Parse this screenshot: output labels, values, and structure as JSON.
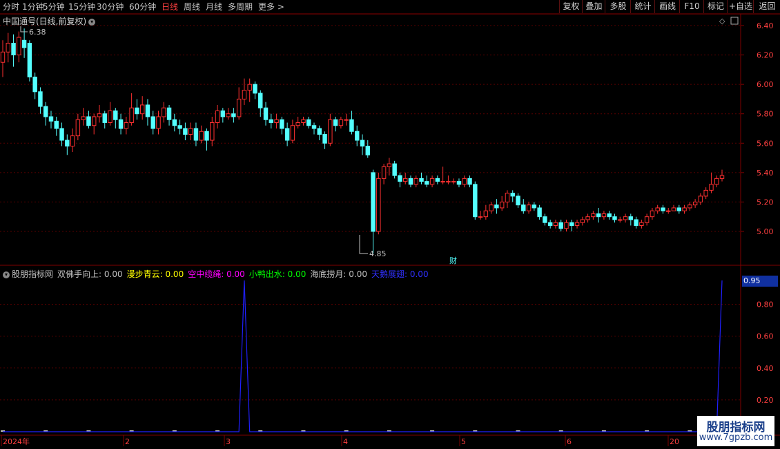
{
  "toolbar": {
    "period_tabs": [
      "分时",
      "1分钟",
      "5分钟",
      "15分钟",
      "30分钟",
      "60分钟",
      "日线",
      "周线",
      "月线",
      "多周期",
      "更多 >"
    ],
    "active_tab": "日线",
    "right_buttons": [
      "复权",
      "叠加",
      "多股",
      "统计",
      "画线",
      "F10",
      "标记",
      "+自选",
      "返回"
    ]
  },
  "main_chart": {
    "title": "中国通号(日线,前复权)",
    "high_label": "6.38",
    "low_label": "4.85",
    "finance_marker": "财",
    "y_ticks": [
      "6.40",
      "6.20",
      "6.00",
      "5.80",
      "5.60",
      "5.40",
      "5.20",
      "5.00"
    ],
    "up_color": "#ff3030",
    "down_color": "#54ffff"
  },
  "indicator": {
    "title": "股朋指标网",
    "items": [
      {
        "name": "双佛手向上",
        "value": "0.00",
        "color": "#c0c0c0"
      },
      {
        "name": "漫步青云",
        "value": "0.00",
        "color": "#ffff00"
      },
      {
        "name": "空中缆绳",
        "value": "0.00",
        "color": "#ff00ff"
      },
      {
        "name": "小鸭出水",
        "value": "0.00",
        "color": "#00ff00"
      },
      {
        "name": "海底捞月",
        "value": "0.00",
        "color": "#c0c0c0"
      },
      {
        "name": "天鹅展翅",
        "value": "0.00",
        "color": "#3030ff"
      }
    ],
    "current_value": "0.95",
    "y_ticks": [
      "0.80",
      "0.60",
      "0.40",
      "0.20"
    ]
  },
  "x_axis": {
    "labels": [
      "2024年",
      "2",
      "3",
      "4",
      "5",
      "6",
      "20"
    ]
  },
  "watermark": {
    "line1": "股朋指标网",
    "line2": "www.7gpzb.com"
  },
  "chart_data": {
    "type": "candlestick",
    "title": "中国通号(日线,前复权)",
    "ylim": [
      4.8,
      6.45
    ],
    "candles": [
      [
        6.15,
        6.22,
        6.3,
        6.05
      ],
      [
        6.22,
        6.28,
        6.35,
        6.15
      ],
      [
        6.28,
        6.2,
        6.34,
        6.12
      ],
      [
        6.2,
        6.32,
        6.36,
        6.15
      ],
      [
        6.3,
        6.25,
        6.38,
        6.18
      ],
      [
        6.28,
        6.05,
        6.3,
        6.02
      ],
      [
        6.05,
        5.95,
        6.08,
        5.9
      ],
      [
        5.95,
        5.85,
        5.98,
        5.8
      ],
      [
        5.85,
        5.78,
        5.88,
        5.72
      ],
      [
        5.78,
        5.75,
        5.82,
        5.7
      ],
      [
        5.75,
        5.7,
        5.78,
        5.65
      ],
      [
        5.7,
        5.62,
        5.74,
        5.58
      ],
      [
        5.62,
        5.58,
        5.66,
        5.52
      ],
      [
        5.58,
        5.65,
        5.7,
        5.54
      ],
      [
        5.65,
        5.76,
        5.8,
        5.62
      ],
      [
        5.76,
        5.78,
        5.84,
        5.72
      ],
      [
        5.78,
        5.72,
        5.82,
        5.7
      ],
      [
        5.72,
        5.78,
        5.8,
        5.66
      ],
      [
        5.78,
        5.8,
        5.86,
        5.74
      ],
      [
        5.8,
        5.74,
        5.82,
        5.7
      ],
      [
        5.74,
        5.82,
        5.88,
        5.72
      ],
      [
        5.82,
        5.76,
        5.84,
        5.7
      ],
      [
        5.76,
        5.7,
        5.8,
        5.66
      ],
      [
        5.7,
        5.74,
        5.78,
        5.66
      ],
      [
        5.74,
        5.84,
        5.94,
        5.72
      ],
      [
        5.84,
        5.8,
        5.9,
        5.76
      ],
      [
        5.8,
        5.86,
        5.92,
        5.76
      ],
      [
        5.86,
        5.78,
        5.9,
        5.72
      ],
      [
        5.78,
        5.7,
        5.82,
        5.66
      ],
      [
        5.7,
        5.78,
        5.82,
        5.66
      ],
      [
        5.78,
        5.84,
        5.88,
        5.74
      ],
      [
        5.84,
        5.76,
        5.86,
        5.72
      ],
      [
        5.76,
        5.72,
        5.8,
        5.68
      ],
      [
        5.72,
        5.7,
        5.76,
        5.66
      ],
      [
        5.7,
        5.66,
        5.74,
        5.62
      ],
      [
        5.66,
        5.7,
        5.74,
        5.62
      ],
      [
        5.7,
        5.62,
        5.74,
        5.58
      ],
      [
        5.62,
        5.68,
        5.72,
        5.6
      ],
      [
        5.68,
        5.62,
        5.7,
        5.55
      ],
      [
        5.62,
        5.74,
        5.78,
        5.58
      ],
      [
        5.74,
        5.82,
        5.86,
        5.7
      ],
      [
        5.82,
        5.78,
        5.84,
        5.74
      ],
      [
        5.78,
        5.8,
        5.84,
        5.76
      ],
      [
        5.8,
        5.78,
        5.84,
        5.74
      ],
      [
        5.78,
        5.9,
        5.98,
        5.76
      ],
      [
        5.9,
        5.96,
        6.04,
        5.86
      ],
      [
        5.96,
        6.0,
        6.04,
        5.88
      ],
      [
        6.0,
        5.94,
        6.02,
        5.9
      ],
      [
        5.94,
        5.84,
        5.96,
        5.78
      ],
      [
        5.84,
        5.76,
        5.88,
        5.72
      ],
      [
        5.76,
        5.74,
        5.8,
        5.7
      ],
      [
        5.74,
        5.76,
        5.8,
        5.7
      ],
      [
        5.76,
        5.7,
        5.78,
        5.66
      ],
      [
        5.7,
        5.62,
        5.74,
        5.58
      ],
      [
        5.62,
        5.72,
        5.76,
        5.6
      ],
      [
        5.72,
        5.74,
        5.78,
        5.7
      ],
      [
        5.74,
        5.76,
        5.78,
        5.72
      ],
      [
        5.76,
        5.72,
        5.78,
        5.7
      ],
      [
        5.72,
        5.7,
        5.74,
        5.66
      ],
      [
        5.7,
        5.66,
        5.72,
        5.62
      ],
      [
        5.66,
        5.6,
        5.68,
        5.56
      ],
      [
        5.6,
        5.76,
        5.8,
        5.58
      ],
      [
        5.76,
        5.72,
        5.78,
        5.68
      ],
      [
        5.72,
        5.76,
        5.78,
        5.7
      ],
      [
        5.76,
        5.76,
        5.8,
        5.72
      ],
      [
        5.76,
        5.68,
        5.82,
        5.66
      ],
      [
        5.68,
        5.62,
        5.72,
        5.58
      ],
      [
        5.62,
        5.58,
        5.66,
        5.52
      ],
      [
        5.58,
        5.52,
        5.62,
        5.5
      ],
      [
        5.4,
        5.0,
        5.42,
        4.85
      ],
      [
        5.0,
        5.36,
        5.4,
        4.98
      ],
      [
        5.36,
        5.44,
        5.46,
        5.32
      ],
      [
        5.44,
        5.46,
        5.5,
        5.38
      ],
      [
        5.46,
        5.38,
        5.48,
        5.36
      ],
      [
        5.38,
        5.34,
        5.4,
        5.3
      ],
      [
        5.34,
        5.36,
        5.4,
        5.32
      ],
      [
        5.36,
        5.32,
        5.38,
        5.3
      ],
      [
        5.32,
        5.36,
        5.38,
        5.3
      ],
      [
        5.36,
        5.34,
        5.4,
        5.32
      ],
      [
        5.34,
        5.32,
        5.38,
        5.3
      ],
      [
        5.32,
        5.36,
        5.38,
        5.3
      ],
      [
        5.36,
        5.34,
        5.38,
        5.32
      ],
      [
        5.34,
        5.34,
        5.44,
        5.32
      ],
      [
        5.34,
        5.34,
        5.38,
        5.32
      ],
      [
        5.34,
        5.34,
        5.36,
        5.32
      ],
      [
        5.34,
        5.32,
        5.36,
        5.3
      ],
      [
        5.32,
        5.36,
        5.38,
        5.3
      ],
      [
        5.36,
        5.32,
        5.38,
        5.3
      ],
      [
        5.32,
        5.1,
        5.34,
        5.08
      ],
      [
        5.1,
        5.1,
        5.14,
        5.08
      ],
      [
        5.1,
        5.14,
        5.18,
        5.08
      ],
      [
        5.14,
        5.18,
        5.2,
        5.12
      ],
      [
        5.18,
        5.16,
        5.22,
        5.12
      ],
      [
        5.16,
        5.2,
        5.24,
        5.14
      ],
      [
        5.2,
        5.26,
        5.28,
        5.16
      ],
      [
        5.26,
        5.24,
        5.28,
        5.2
      ],
      [
        5.24,
        5.18,
        5.26,
        5.16
      ],
      [
        5.18,
        5.14,
        5.22,
        5.12
      ],
      [
        5.14,
        5.18,
        5.2,
        5.12
      ],
      [
        5.18,
        5.16,
        5.2,
        5.14
      ],
      [
        5.16,
        5.1,
        5.18,
        5.08
      ],
      [
        5.1,
        5.06,
        5.12,
        5.04
      ],
      [
        5.06,
        5.04,
        5.08,
        5.02
      ],
      [
        5.04,
        5.06,
        5.08,
        5.02
      ],
      [
        5.06,
        5.02,
        5.08,
        5.0
      ],
      [
        5.02,
        5.06,
        5.08,
        5.0
      ],
      [
        5.06,
        5.04,
        5.08,
        5.0
      ],
      [
        5.04,
        5.06,
        5.08,
        5.02
      ],
      [
        5.06,
        5.08,
        5.1,
        5.04
      ],
      [
        5.08,
        5.1,
        5.12,
        5.06
      ],
      [
        5.1,
        5.12,
        5.14,
        5.08
      ],
      [
        5.12,
        5.1,
        5.16,
        5.06
      ],
      [
        5.1,
        5.12,
        5.14,
        5.08
      ],
      [
        5.12,
        5.1,
        5.14,
        5.08
      ],
      [
        5.1,
        5.08,
        5.12,
        5.06
      ],
      [
        5.08,
        5.08,
        5.1,
        5.06
      ],
      [
        5.08,
        5.1,
        5.12,
        5.06
      ],
      [
        5.1,
        5.08,
        5.12,
        5.04
      ],
      [
        5.08,
        5.04,
        5.1,
        5.02
      ],
      [
        5.04,
        5.06,
        5.08,
        5.02
      ],
      [
        5.06,
        5.1,
        5.12,
        5.04
      ],
      [
        5.1,
        5.14,
        5.16,
        5.08
      ],
      [
        5.14,
        5.16,
        5.18,
        5.12
      ],
      [
        5.16,
        5.14,
        5.18,
        5.12
      ],
      [
        5.14,
        5.14,
        5.16,
        5.12
      ],
      [
        5.14,
        5.16,
        5.18,
        5.14
      ],
      [
        5.16,
        5.14,
        5.18,
        5.12
      ],
      [
        5.14,
        5.16,
        5.18,
        5.12
      ],
      [
        5.16,
        5.18,
        5.2,
        5.14
      ],
      [
        5.18,
        5.2,
        5.22,
        5.16
      ],
      [
        5.2,
        5.24,
        5.26,
        5.18
      ],
      [
        5.24,
        5.28,
        5.3,
        5.22
      ],
      [
        5.28,
        5.32,
        5.4,
        5.26
      ],
      [
        5.32,
        5.36,
        5.38,
        5.3
      ],
      [
        5.36,
        5.38,
        5.42,
        5.34
      ]
    ],
    "indicator_series": {
      "name": "天鹅展翅",
      "spikes": [
        {
          "index": 45,
          "value": 0.95
        },
        {
          "index": 134,
          "value": 0.95
        }
      ]
    }
  }
}
